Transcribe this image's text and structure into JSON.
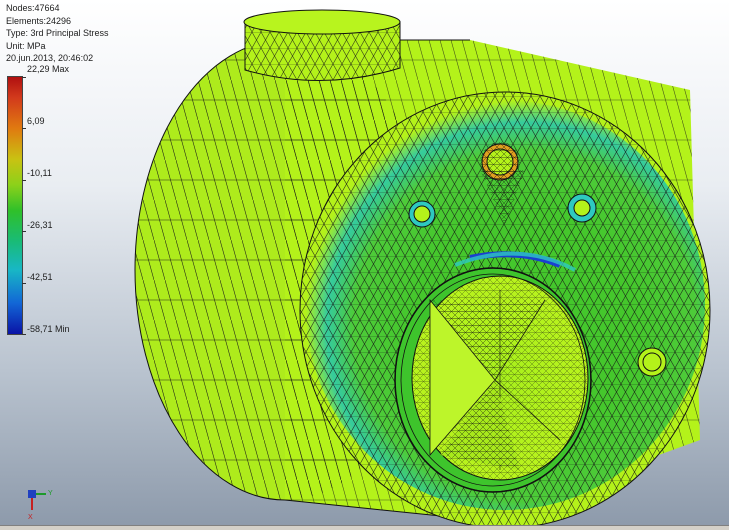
{
  "info": {
    "nodes": "Nodes:47664",
    "elements": "Elements:24296",
    "type": "Type: 3rd Principal Stress",
    "unit": "Unit: MPa",
    "date": "20.jun.2013, 20:46:02"
  },
  "legend": {
    "labels": [
      "22,29 Max",
      "6,09",
      "-10,11",
      "-26,31",
      "-42,51",
      "-58,71 Min"
    ]
  },
  "triad": {
    "y_label": "Y",
    "x_label": "X"
  },
  "colors": {
    "mesh_fill": "#b4f21a",
    "mesh_fill_shadow": "#9fd81c",
    "mesh_lines": "#111111",
    "stress_green": "#3ec42c",
    "stress_cyan": "#2ec9c0",
    "stress_blue": "#1a3fd0"
  }
}
